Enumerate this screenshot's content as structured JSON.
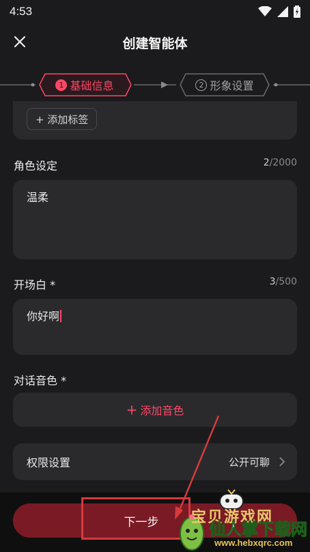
{
  "status_bar": {
    "time": "4:53"
  },
  "header": {
    "title": "创建智能体"
  },
  "stepper": {
    "steps": [
      {
        "number": "1",
        "label": "基础信息",
        "active": true
      },
      {
        "number": "2",
        "label": "形象设置",
        "active": false
      }
    ]
  },
  "tags": {
    "add_label": "+ 添加标签"
  },
  "role": {
    "label": "角色设定",
    "count": "2",
    "max": "/2000",
    "value": "温柔"
  },
  "opening": {
    "label": "开场白 *",
    "count": "3",
    "max": "/500",
    "value": "你好啊"
  },
  "voice": {
    "label": "对话音色 *",
    "add_label": "添加音色",
    "add_icon": "+"
  },
  "permission": {
    "label": "权限设置",
    "value": "公开可聊"
  },
  "footer": {
    "next_label": "下一步"
  },
  "watermark": {
    "title": "宝贝游戏网",
    "main": "仙人掌下载网",
    "url": "www.hebxqrc.com"
  },
  "colors": {
    "accent": "#ff4766",
    "next_button": "#7a1a25",
    "background": "#1b1b1d",
    "card": "#2a2a2d"
  }
}
